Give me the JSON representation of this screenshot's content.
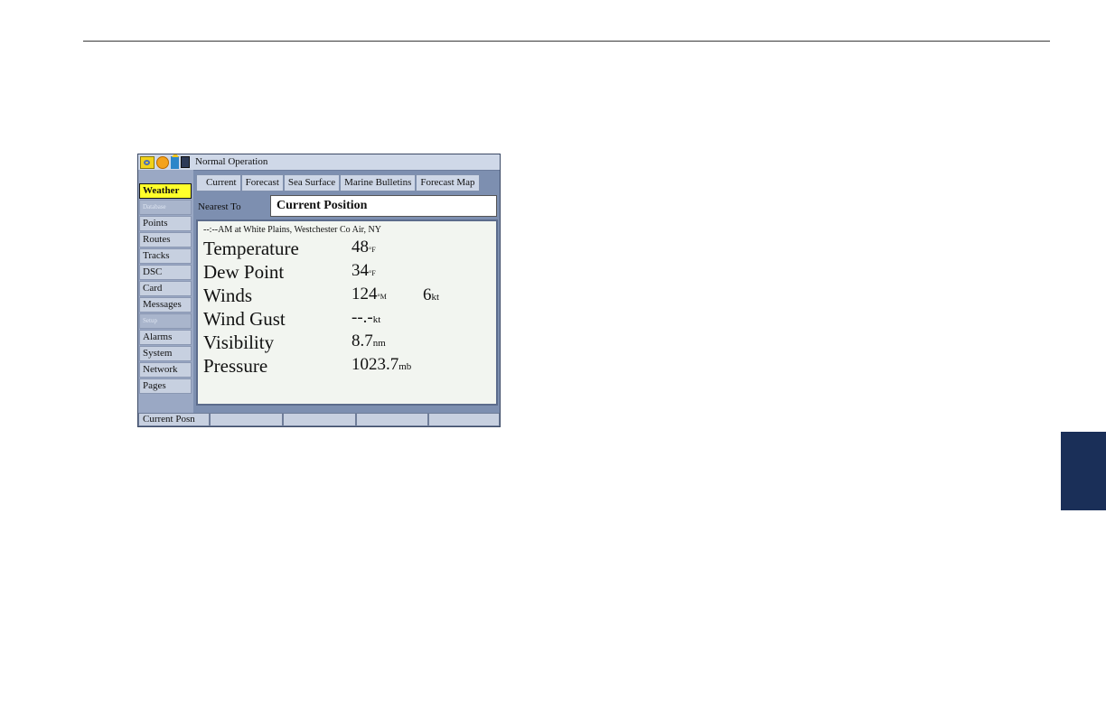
{
  "device": {
    "title": "Normal Operation",
    "status_icons": [
      "satellite-icon",
      "sun-icon",
      "house-icon",
      "card-icon"
    ]
  },
  "nav": {
    "items": [
      {
        "label": "Weather",
        "state": "selected"
      },
      {
        "label": "Database",
        "state": "header"
      },
      {
        "label": "Points",
        "state": "normal"
      },
      {
        "label": "Routes",
        "state": "normal"
      },
      {
        "label": "Tracks",
        "state": "normal"
      },
      {
        "label": "DSC",
        "state": "normal"
      },
      {
        "label": "Card",
        "state": "normal"
      },
      {
        "label": "Messages",
        "state": "normal"
      },
      {
        "label": "Setup",
        "state": "header"
      },
      {
        "label": "Alarms",
        "state": "normal"
      },
      {
        "label": "System",
        "state": "normal"
      },
      {
        "label": "Network",
        "state": "normal"
      },
      {
        "label": "Pages",
        "state": "normal"
      }
    ]
  },
  "tabs": [
    "Current",
    "Forecast",
    "Sea Surface",
    "Marine Bulletins",
    "Forecast Map"
  ],
  "nearest": {
    "label": "Nearest To",
    "value": "Current Position"
  },
  "weather": {
    "station": "--:--AM at White Plains, Westchester Co Air, NY",
    "temperature": {
      "label": "Temperature",
      "value": "48",
      "unit": "°F"
    },
    "dew_point": {
      "label": "Dew Point",
      "value": "34",
      "unit": "°F"
    },
    "winds": {
      "label": "Winds",
      "direction": "124",
      "direction_unit": "°M",
      "speed": "6",
      "speed_unit": "kt"
    },
    "wind_gust": {
      "label": "Wind Gust",
      "value": "--.-",
      "unit": "kt"
    },
    "visibility": {
      "label": "Visibility",
      "value": "8.7",
      "unit": "nm"
    },
    "pressure": {
      "label": "Pressure",
      "value": "1023.7",
      "unit": "mb"
    }
  },
  "softkeys": [
    "Current Posn",
    "",
    "",
    "",
    ""
  ],
  "colors": {
    "selected_nav": "#ffff2a",
    "side_tab": "#1a2f58",
    "device_frame": "#7d8fb0"
  }
}
